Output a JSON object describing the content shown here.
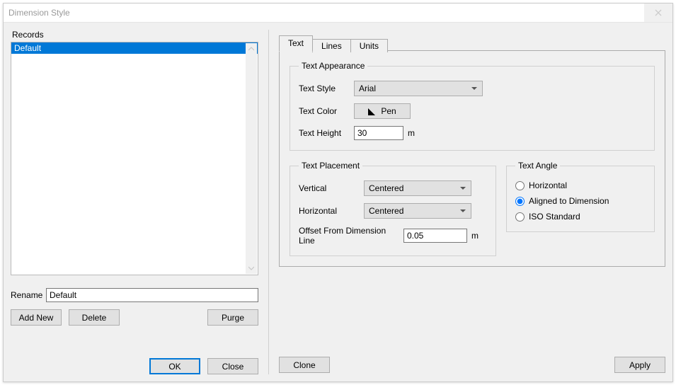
{
  "title": "Dimension Style",
  "records_label": "Records",
  "records": [
    "Default"
  ],
  "selected_record_index": 0,
  "rename_label": "Rename",
  "rename_value": "Default",
  "buttons": {
    "add_new": "Add New",
    "delete": "Delete",
    "purge": "Purge",
    "ok": "OK",
    "close": "Close",
    "clone": "Clone",
    "apply": "Apply"
  },
  "tabs": [
    "Text",
    "Lines",
    "Units"
  ],
  "active_tab_index": 0,
  "text_panel": {
    "appearance": {
      "legend": "Text Appearance",
      "text_style_label": "Text Style",
      "text_style_value": "Arial",
      "text_color_label": "Text Color",
      "pen_label": "Pen",
      "text_height_label": "Text Height",
      "text_height_value": "30",
      "text_height_unit": "m"
    },
    "placement": {
      "legend": "Text Placement",
      "vertical_label": "Vertical",
      "vertical_value": "Centered",
      "horizontal_label": "Horizontal",
      "horizontal_value": "Centered",
      "offset_label": "Offset From Dimension Line",
      "offset_value": "0.05",
      "offset_unit": "m"
    },
    "angle": {
      "legend": "Text Angle",
      "options": [
        "Horizontal",
        "Aligned to Dimension",
        "ISO Standard"
      ],
      "selected_index": 1
    }
  }
}
